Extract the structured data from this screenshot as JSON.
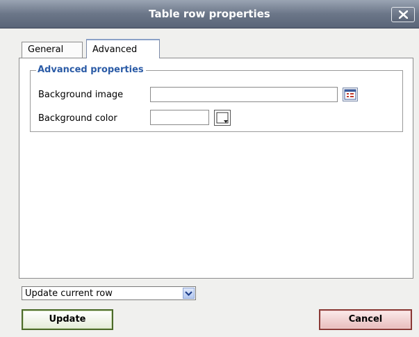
{
  "dialog": {
    "title": "Table row properties"
  },
  "tabs": [
    {
      "label": "General",
      "active": false
    },
    {
      "label": "Advanced",
      "active": true
    }
  ],
  "advanced": {
    "legend": "Advanced properties",
    "background_image": {
      "label": "Background image",
      "value": ""
    },
    "background_color": {
      "label": "Background color",
      "value": ""
    }
  },
  "scope_select": {
    "selected": "Update current row"
  },
  "buttons": {
    "update": "Update",
    "cancel": "Cancel"
  },
  "icons": {
    "close": "close-icon",
    "browse": "browse-icon",
    "color_picker": "color-picker-icon",
    "dropdown": "chevron-down-icon"
  }
}
